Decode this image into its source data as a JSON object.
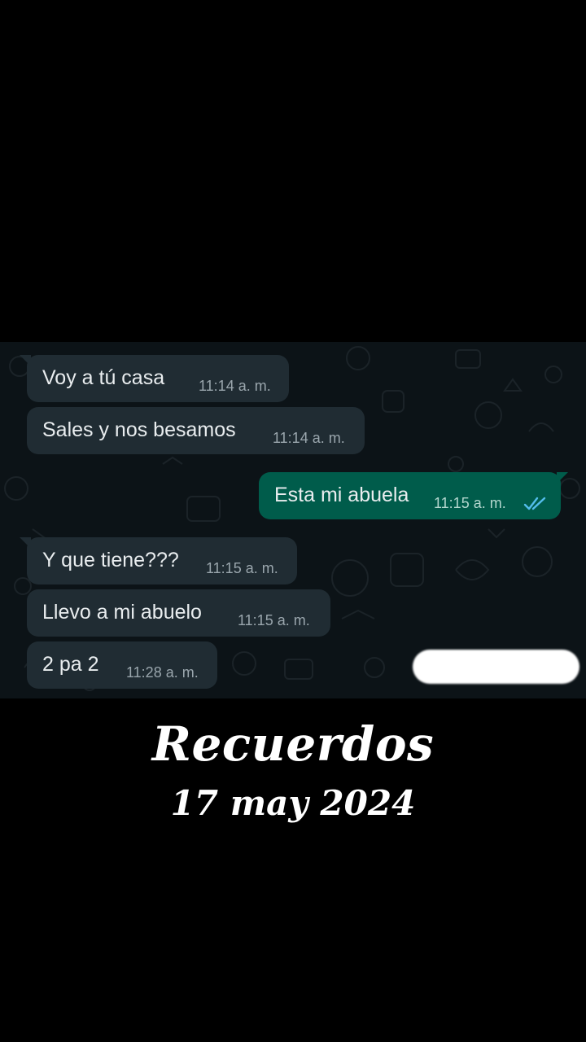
{
  "chat": {
    "messages": [
      {
        "text": "Voy a tú casa",
        "time": "11:14 a. m.",
        "direction": "incoming"
      },
      {
        "text": "Sales y nos besamos",
        "time": "11:14 a. m.",
        "direction": "incoming"
      },
      {
        "text": "Esta mi abuela",
        "time": "11:15 a. m.",
        "direction": "outgoing",
        "status": "read-double-check"
      },
      {
        "text": "Y que tiene???",
        "time": "11:15 a. m.",
        "direction": "incoming"
      },
      {
        "text": "Llevo a mi abuelo",
        "time": "11:15 a. m.",
        "direction": "incoming"
      },
      {
        "text": "2 pa 2",
        "time": "11:28 a. m.",
        "direction": "incoming"
      }
    ],
    "colors": {
      "background": "#0c1317",
      "incoming_bubble": "#202c33",
      "outgoing_bubble": "#005c4b",
      "read_ticks": "#53bdeb"
    }
  },
  "caption": {
    "title": "Recuerdos",
    "date": "17 may 2024"
  }
}
